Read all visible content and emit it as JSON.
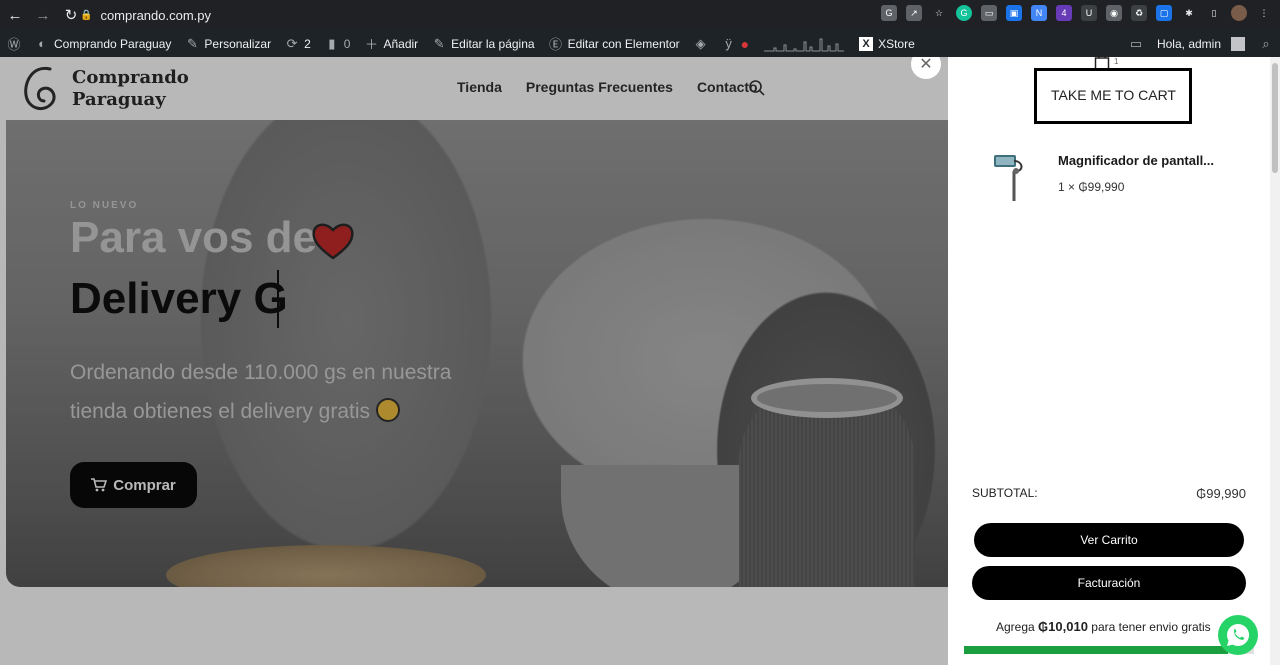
{
  "browser": {
    "url": "comprando.com.py"
  },
  "admin_bar": {
    "site_name": "Comprando Paraguay",
    "customize": "Personalizar",
    "updates_count": "2",
    "comments_count": "0",
    "add_new": "Añadir",
    "edit_page": "Editar la página",
    "edit_elementor": "Editar con Elementor",
    "xstore": "XStore",
    "greeting": "Hola, admin"
  },
  "header": {
    "logo_line1": "Comprando",
    "logo_line2": "Paraguay",
    "menu": [
      "Tienda",
      "Preguntas Frecuentes",
      "Contacto"
    ]
  },
  "hero": {
    "eyebrow": "LO NUEVO",
    "title_line1": "Para vos de",
    "title_line2": "Delivery G",
    "lead_line1": "Ordenando desde 110.000 gs en nuestra",
    "lead_line2": "tienda obtienes el delivery gratis",
    "cta": "Comprar"
  },
  "cart": {
    "count": "1",
    "take_me": "TAKE ME TO CART",
    "item": {
      "name": "Magnificador de pantall...",
      "qty_price": "1 × ₲99,990"
    },
    "subtotal_label": "SUBTOTAL:",
    "subtotal_value": "₲99,990",
    "view_cart": "Ver Carrito",
    "checkout": "Facturación",
    "shipping_pre": "Agrega",
    "shipping_amount": "₲10,010",
    "shipping_post": "para tener envio gratis",
    "shipping_progress": 0.909
  },
  "colors": {
    "accent_green": "#1b9e3e",
    "whatsapp": "#25d366"
  }
}
